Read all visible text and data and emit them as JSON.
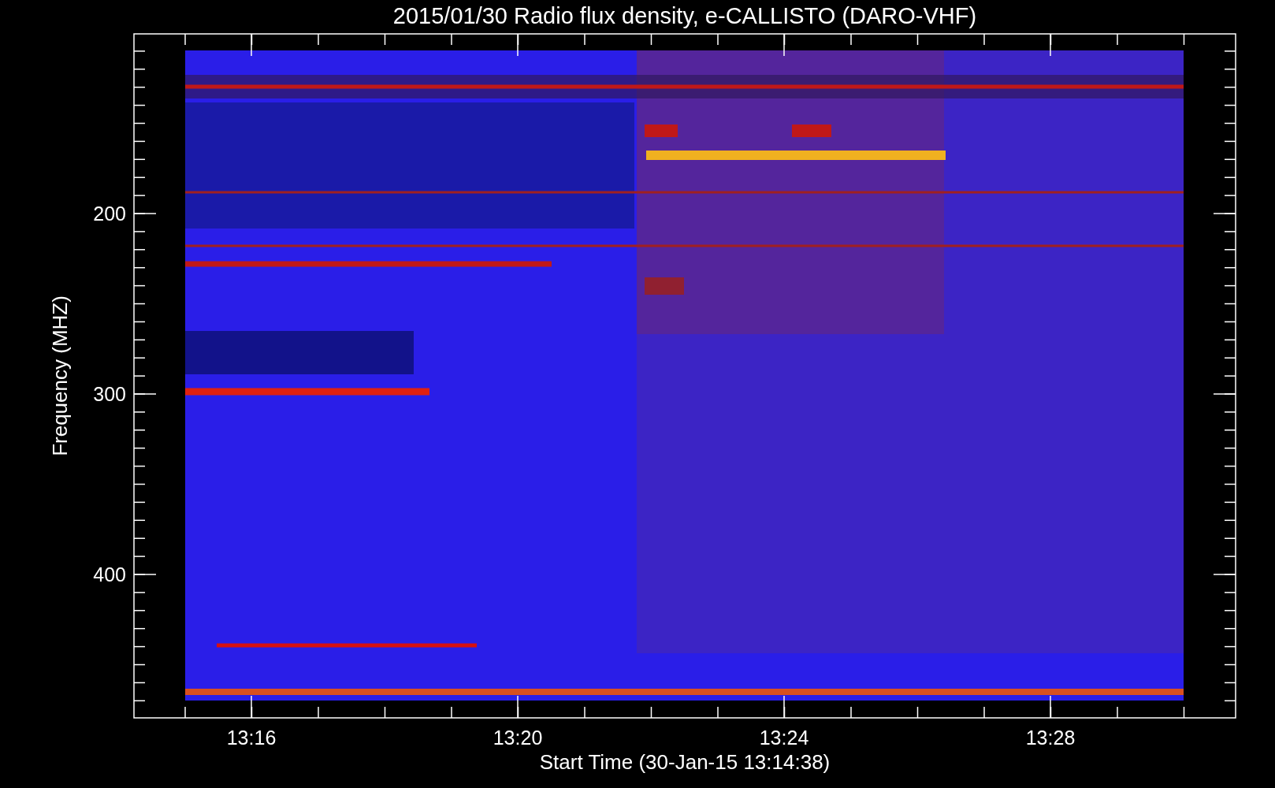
{
  "plot": {
    "title": "2015/01/30  Radio flux density, e-CALLISTO (DARO-VHF)",
    "x_axis": {
      "label": "Start Time (30-Jan-15 13:14:38)",
      "ticks": [
        "13:16",
        "13:20",
        "13:24",
        "13:28"
      ]
    },
    "y_axis": {
      "label": "Frequency (MHZ)",
      "ticks": [
        "200",
        "300",
        "400"
      ]
    }
  }
}
